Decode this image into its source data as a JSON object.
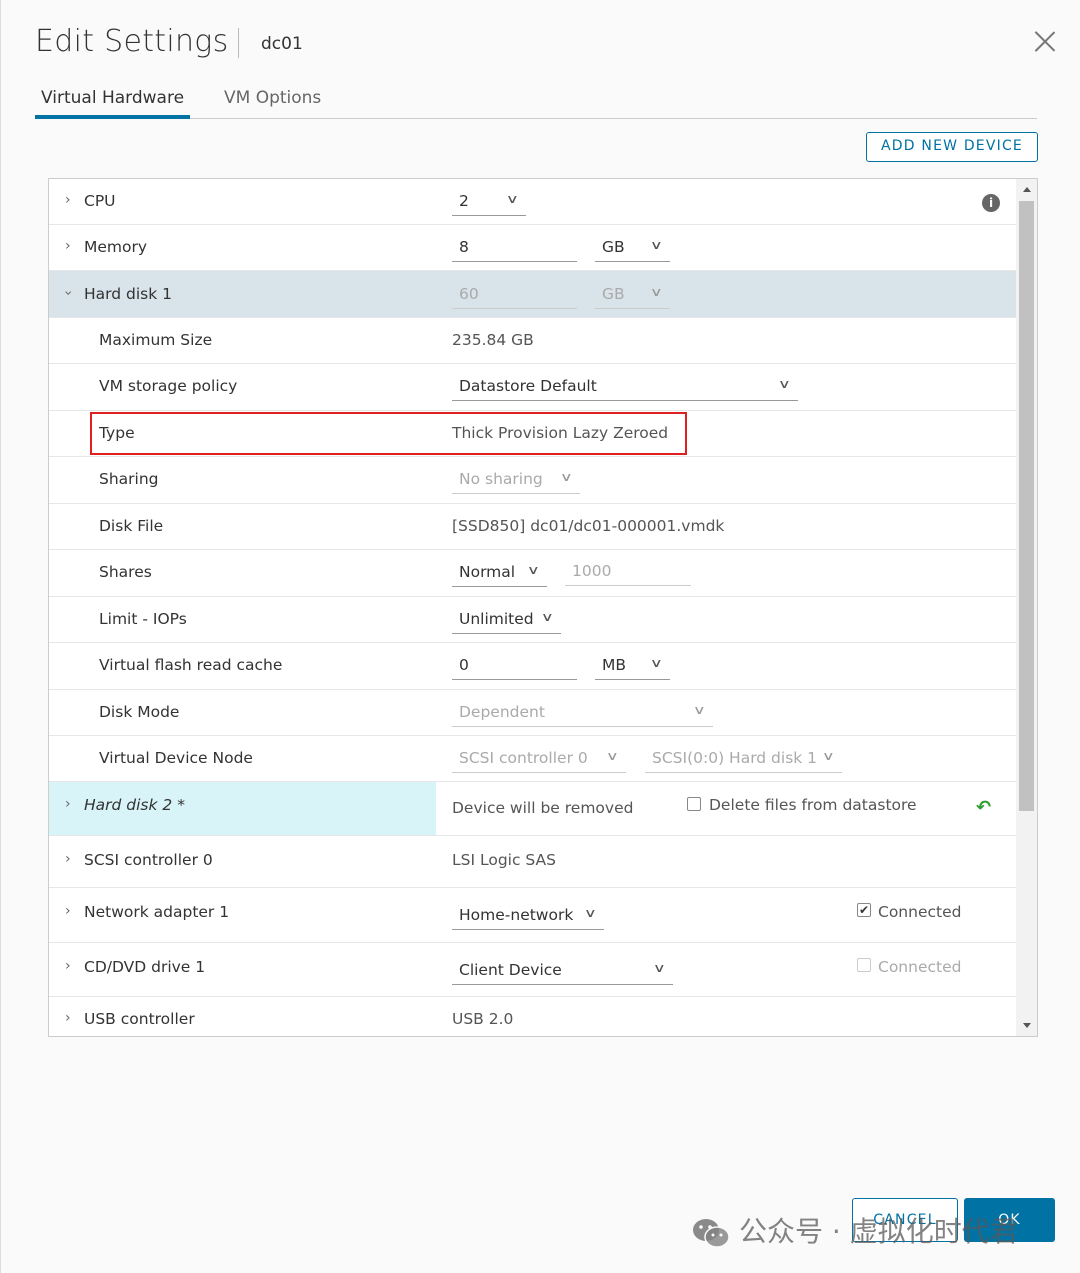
{
  "dialog": {
    "title": "Edit Settings",
    "vm_name": "dc01"
  },
  "tabs": [
    {
      "label": "Virtual Hardware",
      "active": true
    },
    {
      "label": "VM Options",
      "active": false
    }
  ],
  "toolbar": {
    "add_device_label": "ADD NEW DEVICE"
  },
  "hardware": {
    "cpu": {
      "label": "CPU",
      "value": "2"
    },
    "memory": {
      "label": "Memory",
      "value": "8",
      "unit": "GB"
    },
    "hard_disk_1": {
      "label": "Hard disk 1",
      "size": "60",
      "unit": "GB",
      "max_size": {
        "label": "Maximum Size",
        "value": "235.84 GB"
      },
      "storage_policy": {
        "label": "VM storage policy",
        "value": "Datastore Default"
      },
      "type": {
        "label": "Type",
        "value": "Thick Provision Lazy Zeroed"
      },
      "sharing": {
        "label": "Sharing",
        "value": "No sharing"
      },
      "disk_file": {
        "label": "Disk File",
        "value": "[SSD850] dc01/dc01-000001.vmdk"
      },
      "shares": {
        "label": "Shares",
        "value": "Normal",
        "amount": "1000"
      },
      "limit_iops": {
        "label": "Limit - IOPs",
        "value": "Unlimited"
      },
      "flash_cache": {
        "label": "Virtual flash read cache",
        "value": "0",
        "unit": "MB"
      },
      "disk_mode": {
        "label": "Disk Mode",
        "value": "Dependent"
      },
      "device_node": {
        "label": "Virtual Device Node",
        "controller": "SCSI controller 0",
        "node": "SCSI(0:0) Hard disk 1"
      }
    },
    "hard_disk_2": {
      "label": "Hard disk 2 *",
      "status": "Device will be removed",
      "delete_label": "Delete files from datastore"
    },
    "scsi_controller": {
      "label": "SCSI controller 0",
      "value": "LSI Logic SAS"
    },
    "network_adapter": {
      "label": "Network adapter 1",
      "value": "Home-network",
      "connected_label": "Connected",
      "connected": true
    },
    "cd_dvd": {
      "label": "CD/DVD drive 1",
      "value": "Client Device",
      "connected_label": "Connected",
      "connected": false
    },
    "usb_controller": {
      "label": "USB controller",
      "value": "USB 2.0"
    }
  },
  "footer": {
    "cancel_label": "CANCEL",
    "ok_label": "OK"
  },
  "watermark": {
    "text": "公众号 · 虚拟化时代君"
  },
  "icons": {
    "info": "info-icon",
    "close": "close-icon",
    "undo": "undo-icon",
    "chevron": "chevron-down-icon",
    "expand": "chevron-right-icon"
  },
  "colors": {
    "accent": "#0072a3",
    "highlight_row": "#d8e3ea",
    "removed_row": "#d9f4f8",
    "callout": "#e02020"
  }
}
